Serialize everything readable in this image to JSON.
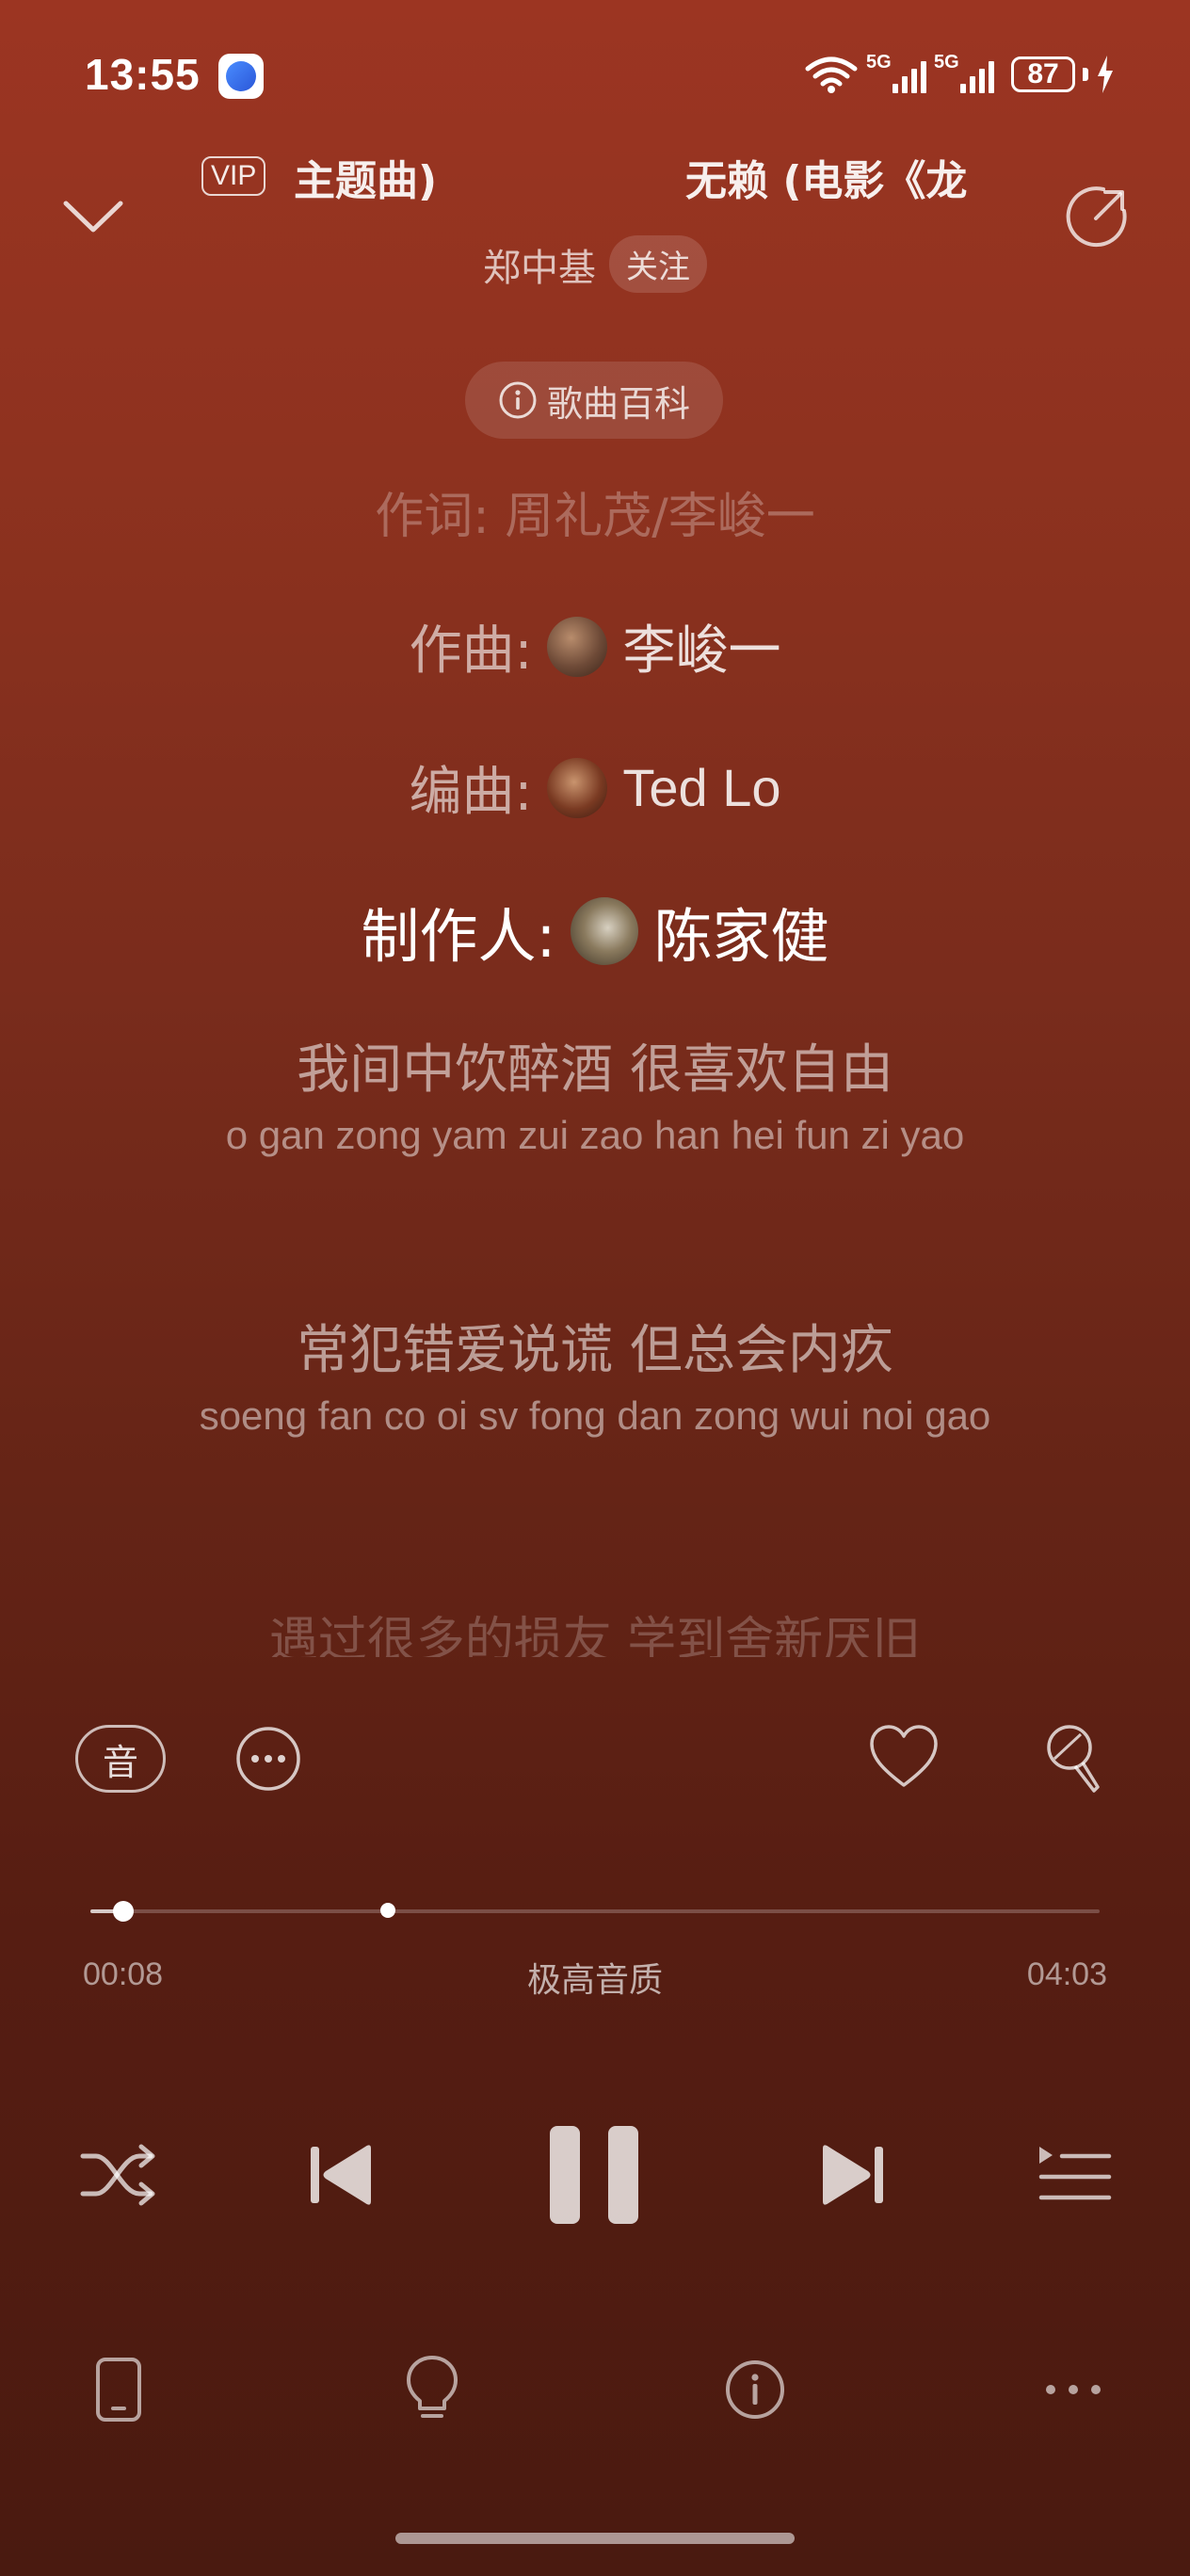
{
  "status_bar": {
    "time": "13:55",
    "network_1": "5G",
    "network_2": "5G",
    "battery": "87"
  },
  "header": {
    "vip_label": "VIP",
    "title_part_a": "主题曲)",
    "title_part_b": "无赖 (电影《龙",
    "artist": "郑中基",
    "follow_label": "关注",
    "wiki_label": "歌曲百科"
  },
  "lyrics": {
    "faded_top": "作词: 周礼茂/李峻一",
    "credits": [
      {
        "role": "作曲:",
        "person": "李峻一"
      },
      {
        "role": "编曲:",
        "person": "Ted Lo"
      },
      {
        "role": "制作人:",
        "person": "陈家健"
      }
    ],
    "lines": [
      {
        "zh": "我间中饮醉酒 很喜欢自由",
        "py": "o gan zong yam zui zao han hei fun zi yao"
      },
      {
        "zh": "常犯错爱说谎 但总会内疚",
        "py": "soeng fan co oi sv fong dan zong wui noi gao"
      }
    ],
    "faded_bottom": "遇过很多的损友 学到舍新厌旧"
  },
  "actions": {
    "quality_short": "音"
  },
  "progress": {
    "elapsed": "00:08",
    "duration": "04:03",
    "quality_label": "极高音质",
    "played_fraction": 0.033,
    "marker_fraction": 0.295
  },
  "icons": {
    "collapse": "chevron-down-icon",
    "share": "share-icon",
    "more": "more-options-icon",
    "like": "heart-icon",
    "karaoke": "microphone-icon",
    "shuffle": "shuffle-icon",
    "prev": "skip-previous-icon",
    "pause": "pause-icon",
    "next": "skip-next-icon",
    "playlist": "playlist-icon",
    "device": "phone-device-icon",
    "bulb": "lightbulb-icon",
    "info": "info-icon",
    "dots": "more-horizontal-icon"
  },
  "colors": {
    "bg_top": "#9c3522",
    "bg_bottom": "#4a1a10"
  }
}
